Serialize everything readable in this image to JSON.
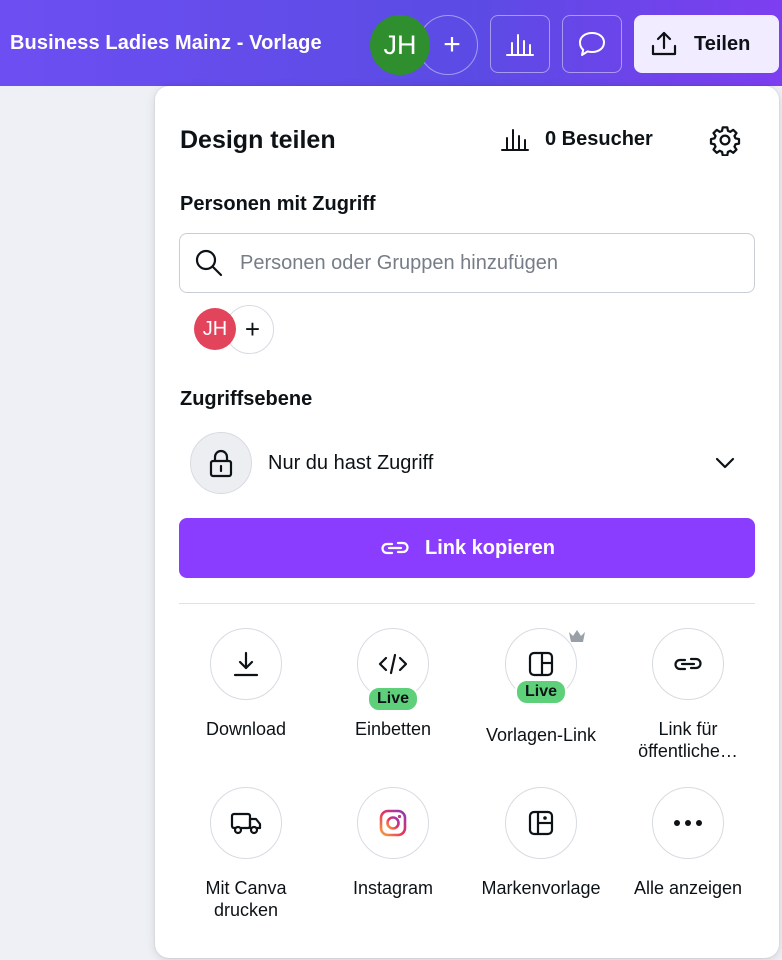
{
  "topbar": {
    "doc_title": "Business Ladies Mainz - Vorlage",
    "avatar_initials": "JH",
    "add_collaborator": "+",
    "share_label": "Teilen"
  },
  "panel": {
    "title": "Design teilen",
    "visitors_label": "0 Besucher",
    "people_section": "Personen mit Zugriff",
    "search_placeholder": "Personen oder Gruppen hinzufügen",
    "member_initials": "JH",
    "member_add": "+",
    "access_section": "Zugriffsebene",
    "access_value": "Nur du hast Zugriff",
    "copy_link_label": "Link kopieren"
  },
  "options": [
    {
      "label": "Download",
      "icon": "download-icon"
    },
    {
      "label": "Einbetten",
      "icon": "embed-icon",
      "badge": "Live"
    },
    {
      "label": "Vorlagen-Link",
      "icon": "template-link-icon",
      "badge": "Live",
      "premium": true
    },
    {
      "label": "Link für öffentliche…",
      "icon": "public-link-icon"
    },
    {
      "label": "Mit Canva drucken",
      "icon": "truck-icon"
    },
    {
      "label": "Instagram",
      "icon": "instagram-icon"
    },
    {
      "label": "Markenvorlage",
      "icon": "brand-template-icon"
    },
    {
      "label": "Alle anzeigen",
      "icon": "more-icon"
    }
  ],
  "colors": {
    "accent": "#8b3dff",
    "topbar_start": "#6d4ef2",
    "topbar_end": "#7d3ef0",
    "live_badge": "#5fd07a",
    "member_avatar": "#e2445c",
    "top_avatar": "#2f8f2f"
  }
}
